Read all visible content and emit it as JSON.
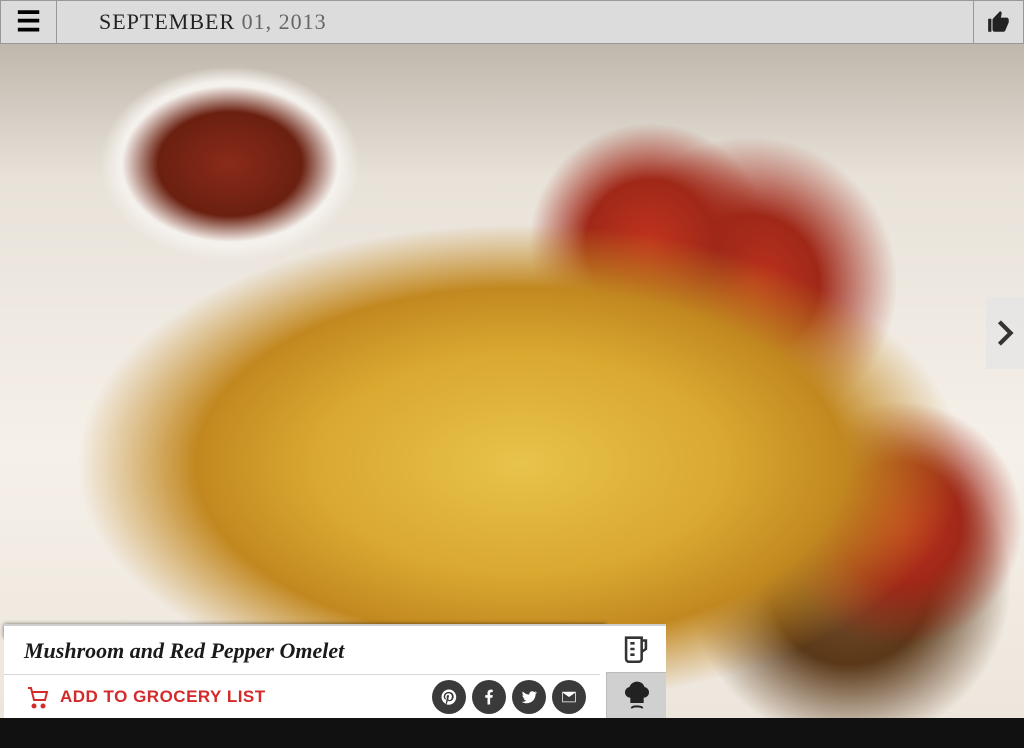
{
  "header": {
    "date_month": "SEPTEMBER",
    "date_rest": " 01, 2013",
    "menu_icon": "hamburger-icon",
    "like_icon": "thumbs-up-icon"
  },
  "hero": {
    "next_icon": "chevron-right-icon"
  },
  "panel": {
    "recipe_title": "Mushroom and Red Pepper Omelet",
    "grocery_label": "ADD TO GROCERY LIST",
    "grocery_icon": "cart-icon",
    "share": {
      "pinterest": "pinterest-icon",
      "facebook": "facebook-icon",
      "twitter": "twitter-icon",
      "email": "email-icon"
    },
    "side": {
      "measure_icon": "measuring-cup-icon",
      "chef_icon": "chef-hat-icon"
    }
  }
}
